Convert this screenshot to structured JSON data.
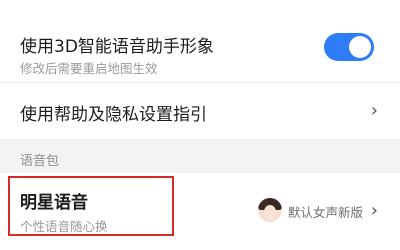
{
  "settings": {
    "avatar_voice": {
      "title": "使用3D智能语音助手形象",
      "subtitle": "修改后需要重启地图生效",
      "toggle_on": true,
      "accent_color": "#2f7df6"
    },
    "help": {
      "title": "使用帮助及隐私设置指引",
      "chevron": "›"
    },
    "voice_pack": {
      "section_label": "语音包",
      "title": "明星语音",
      "subtitle": "个性语音随心换",
      "current_value": "默认女声新版",
      "chevron": "›",
      "highlight_color": "#d62b2b"
    }
  }
}
